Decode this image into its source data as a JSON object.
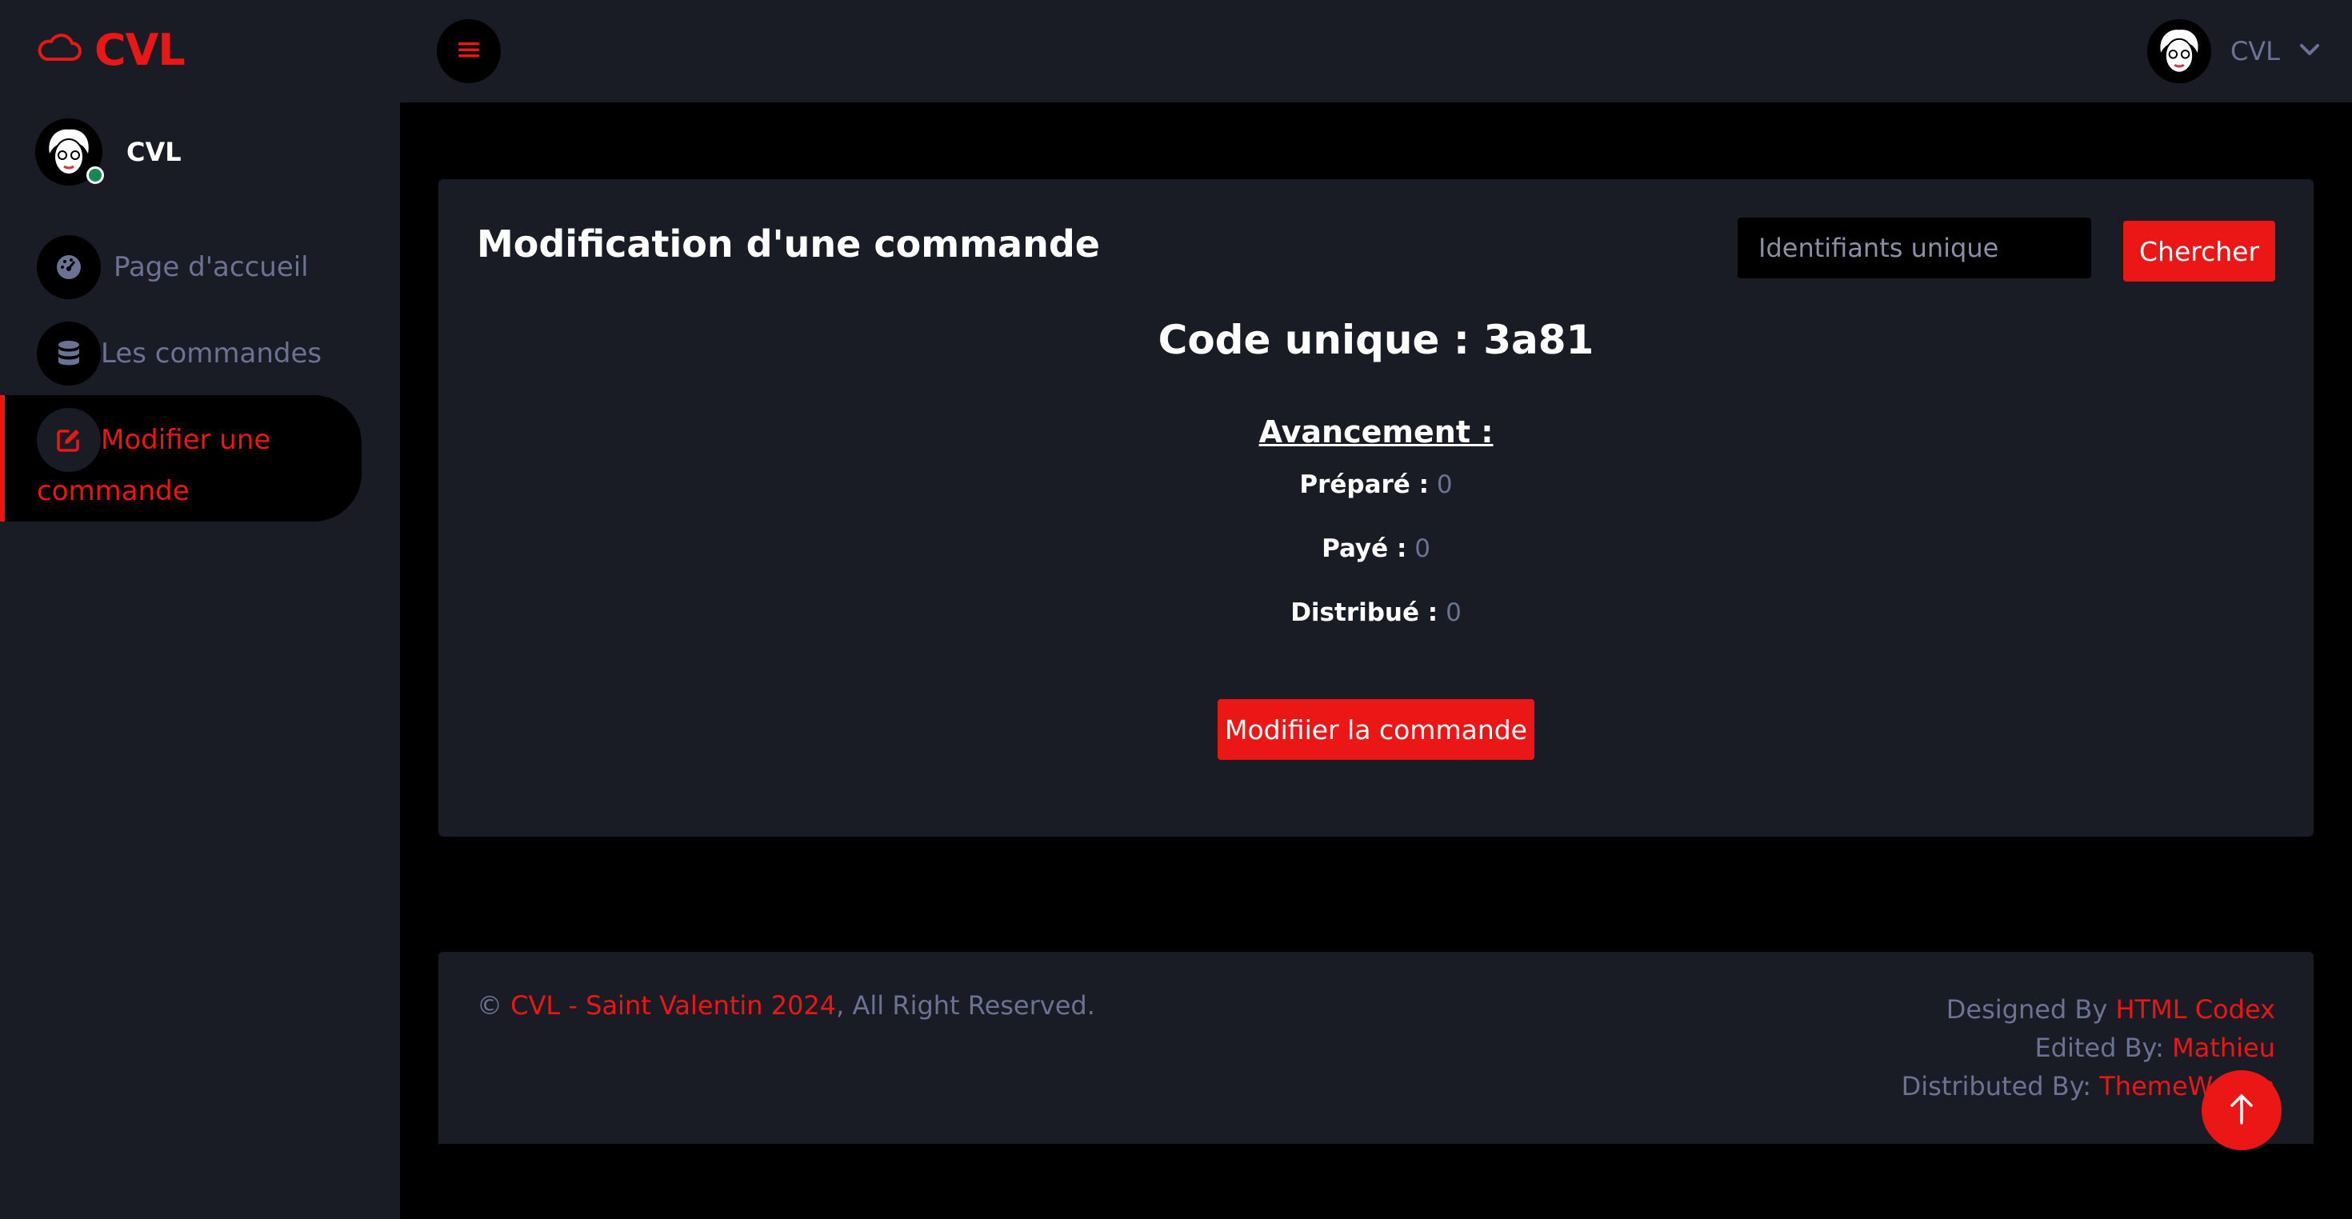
{
  "brand": {
    "name": "CVL",
    "icon": "cloud-icon"
  },
  "sidebar": {
    "profile_name": "CVL",
    "status_color": "#198754",
    "items": [
      {
        "label": "Page d'accueil",
        "icon": "dashboard-gauge-icon",
        "active": false
      },
      {
        "label": "Les commandes",
        "icon": "database-icon",
        "active": false
      },
      {
        "label": "Modifier une commande",
        "label_line1": "Modifier une",
        "label_line2": "commande",
        "icon": "edit-square-icon",
        "active": true
      }
    ]
  },
  "topbar": {
    "menu_icon": "hamburger-icon",
    "user_name": "CVL",
    "dropdown_icon": "chevron-down-icon"
  },
  "card": {
    "title": "Modification d'une commande",
    "search_placeholder": "Identifiants unique",
    "search_value": "",
    "search_button": "Chercher",
    "code_line": "Code unique : 3a81",
    "progress_title": "Avancement :",
    "statuses": [
      {
        "label": "Préparé :",
        "value": "0"
      },
      {
        "label": "Payé :",
        "value": "0"
      },
      {
        "label": "Distribué :",
        "value": "0"
      }
    ],
    "modify_button": "Modifiier la commande"
  },
  "footer": {
    "copyright_symbol": "©",
    "site_link": "CVL - Saint Valentin 2024",
    "rights": ", All Right Reserved.",
    "designed_by_label": "Designed By",
    "designed_by_link": "HTML Codex",
    "edited_by_label": "Edited By:",
    "edited_by_link": "Mathieu",
    "distributed_by_label": "Distributed By:",
    "distributed_by_link": "ThemeWagon"
  },
  "back_to_top_icon": "arrow-up-icon",
  "colors": {
    "accent": "#eb1616",
    "panel": "#191c24",
    "background": "#000000",
    "muted_text": "#6c7293"
  }
}
